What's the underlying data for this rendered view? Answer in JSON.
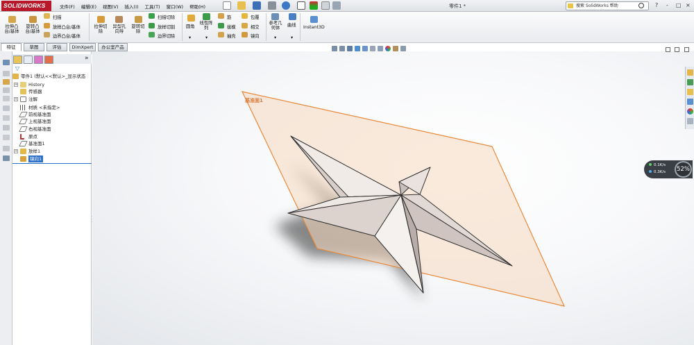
{
  "app": {
    "logo": "SOLIDWORKS",
    "document_title": "零件1 *",
    "menu": [
      "文件(F)",
      "编辑(E)",
      "视图(V)",
      "插入(I)",
      "工具(T)",
      "窗口(W)",
      "帮助(H)"
    ],
    "search_placeholder": "搜索 SolidWorks 帮助",
    "window_buttons": [
      "?",
      "-",
      "□",
      "×"
    ]
  },
  "ribbon": {
    "extrude_boss": "拉伸凸\n台/基体",
    "revolve_boss": "旋转凸\n台/基体",
    "sweep": "扫描",
    "loft_boss": "放样凸台/基体",
    "boundary_boss": "边界凸台/基体",
    "extrude_cut": "拉伸切\n除",
    "hole_wizard": "异型孔\n向导",
    "revolve_cut": "旋转切\n除",
    "swept_cut": "扫描切除",
    "lofted_cut": "放样切割",
    "boundary_cut": "边界切除",
    "fillet": "圆角",
    "linear_pattern": "线性阵\n列",
    "rib": "筋",
    "draft": "拔模",
    "shell": "抽壳",
    "wrap": "包覆",
    "intersect": "相交",
    "mirror": "镜向",
    "reference_geometry": "参考几\n何体",
    "curves": "曲线",
    "instant3d": "Instant3D"
  },
  "tabs": [
    "特征",
    "草图",
    "评估",
    "DimXpert",
    "办公室产品"
  ],
  "tree": {
    "root": "零件1 (默认<<默认>_显示状态",
    "items": [
      "History",
      "传感器",
      "注解",
      "材质 <未指定>",
      "前视基准面",
      "上视基准面",
      "右视基准面",
      "原点",
      "基准面1",
      "放样1",
      "镜向1"
    ]
  },
  "viewport": {
    "plane_label": "基准面1"
  },
  "network": {
    "upload": "0.1K/s",
    "download": "0.3K/s",
    "percent": "52%"
  },
  "colors": {
    "accent_red": "#b8182a",
    "selection_blue": "#2b6fc8",
    "plane_orange": "#e8893a"
  }
}
